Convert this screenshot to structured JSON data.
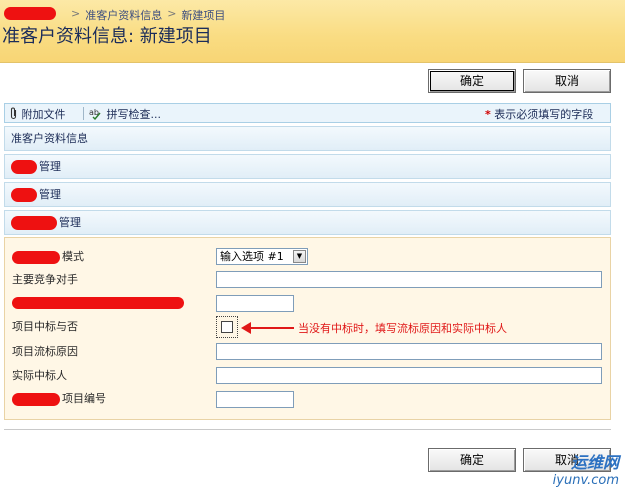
{
  "breadcrumb": {
    "sep1": ">",
    "list": "准客户资料信息",
    "sep2": ">",
    "current": "新建项目"
  },
  "page": {
    "title": "准客户资料信息: 新建项目"
  },
  "buttons": {
    "ok": "确定",
    "cancel": "取消"
  },
  "toolbar": {
    "attach": "附加文件",
    "spell": "拼写检查...",
    "required_star": "*",
    "required_note": "表示必须填写的字段"
  },
  "sections": {
    "s1": "准客户资料信息",
    "s2": "管理",
    "s3": "管理",
    "s4": "管理"
  },
  "form": {
    "mode_label": "模式",
    "mode_value": "输入选项 #1",
    "competitor_label": "主要竞争对手",
    "bid_label": "项目中标与否",
    "fail_reason_label": "项目流标原因",
    "winner_label": "实际中标人",
    "project_no_label": "项目编号"
  },
  "annotation": {
    "text": "当没有中标时，填写流标原因和实际中标人"
  },
  "watermark": {
    "line1": "运维网",
    "line2": "iyunv.com"
  }
}
